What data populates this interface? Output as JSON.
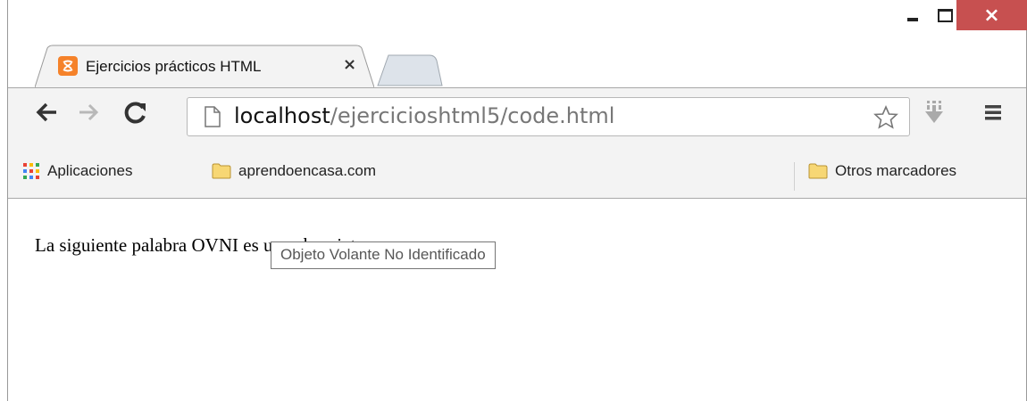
{
  "window": {
    "close_glyph": "×",
    "colors": {
      "close": "#c75050",
      "chrome": "#f3f3f3",
      "border": "#a8a8a8"
    }
  },
  "tab": {
    "title": "Ejercicios prácticos HTML",
    "close_glyph": "×",
    "favicon": "xampp-icon"
  },
  "toolbar": {
    "url_host": "localhost",
    "url_path": "/ejercicioshtml5/code.html",
    "icons": [
      "back-arrow-icon",
      "forward-arrow-icon",
      "reload-icon",
      "page-icon",
      "star-icon",
      "download-icon",
      "menu-icon"
    ]
  },
  "bookmarks": {
    "apps_label": "Aplicaciones",
    "items": [
      {
        "label": "aprendoencasa.com"
      }
    ],
    "other_label": "Otros marcadores"
  },
  "page": {
    "text": "La siguiente palabra OVNI es una abreviatura",
    "tooltip": "Objeto Volante No Identificado"
  }
}
